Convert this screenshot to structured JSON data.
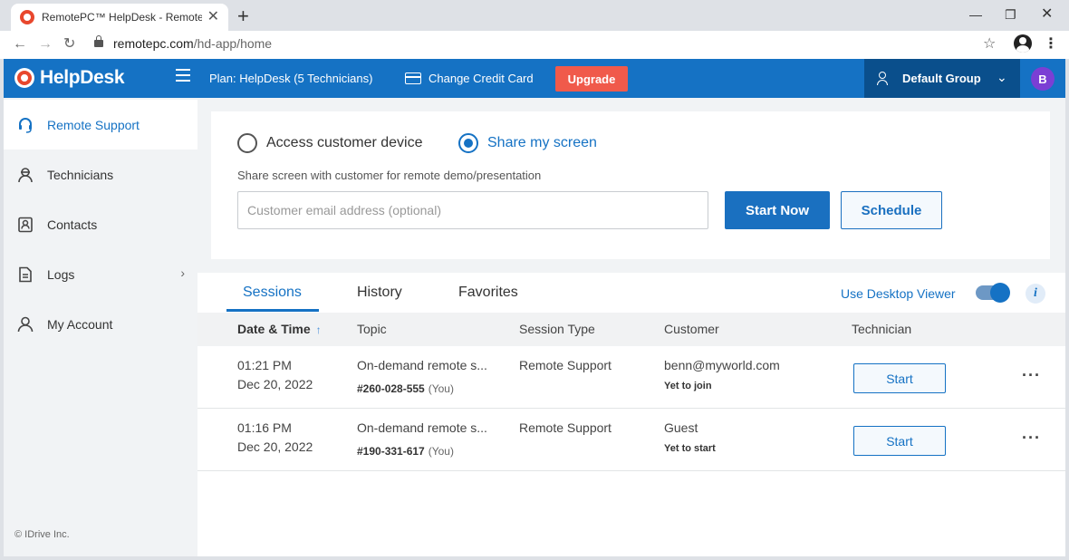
{
  "browser": {
    "tab_title": "RemotePC™ HelpDesk - Remote",
    "url_host": "remotepc.com",
    "url_path": "/hd-app/home"
  },
  "header": {
    "logo": "HelpDesk",
    "plan": "Plan: HelpDesk (5 Technicians)",
    "change_card": "Change Credit Card",
    "upgrade": "Upgrade",
    "group": "Default Group",
    "avatar": "B"
  },
  "sidebar": {
    "items": [
      {
        "label": "Remote Support",
        "icon": "headset-icon"
      },
      {
        "label": "Technicians",
        "icon": "technician-icon"
      },
      {
        "label": "Contacts",
        "icon": "contact-card-icon"
      },
      {
        "label": "Logs",
        "icon": "document-icon"
      },
      {
        "label": "My Account",
        "icon": "user-icon"
      }
    ],
    "copyright": "© IDrive Inc."
  },
  "share": {
    "option_access": "Access customer device",
    "option_share": "Share my screen",
    "description": "Share screen with customer for remote demo/presentation",
    "email_placeholder": "Customer email address (optional)",
    "start_now": "Start Now",
    "schedule": "Schedule"
  },
  "sessions": {
    "tabs": [
      "Sessions",
      "History",
      "Favorites"
    ],
    "desktop_viewer": "Use Desktop Viewer",
    "toggle_on": true,
    "columns": [
      "Date & Time",
      "Topic",
      "Session Type",
      "Customer",
      "Technician"
    ],
    "rows": [
      {
        "time": "01:21 PM",
        "date": "Dec 20, 2022",
        "topic": "On-demand remote s...",
        "session_id": "#260-028-555",
        "you": "(You)",
        "type": "Remote Support",
        "customer": "benn@myworld.com",
        "status": "Yet to join",
        "action": "Start"
      },
      {
        "time": "01:16 PM",
        "date": "Dec 20, 2022",
        "topic": "On-demand remote s...",
        "session_id": "#190-331-617",
        "you": "(You)",
        "type": "Remote Support",
        "customer": "Guest",
        "status": "Yet to start",
        "action": "Start"
      }
    ]
  },
  "colors": {
    "primary": "#1572c4",
    "header_dark": "#0a4f8c",
    "upgrade": "#f05a4b",
    "avatar": "#7b3fd4"
  }
}
